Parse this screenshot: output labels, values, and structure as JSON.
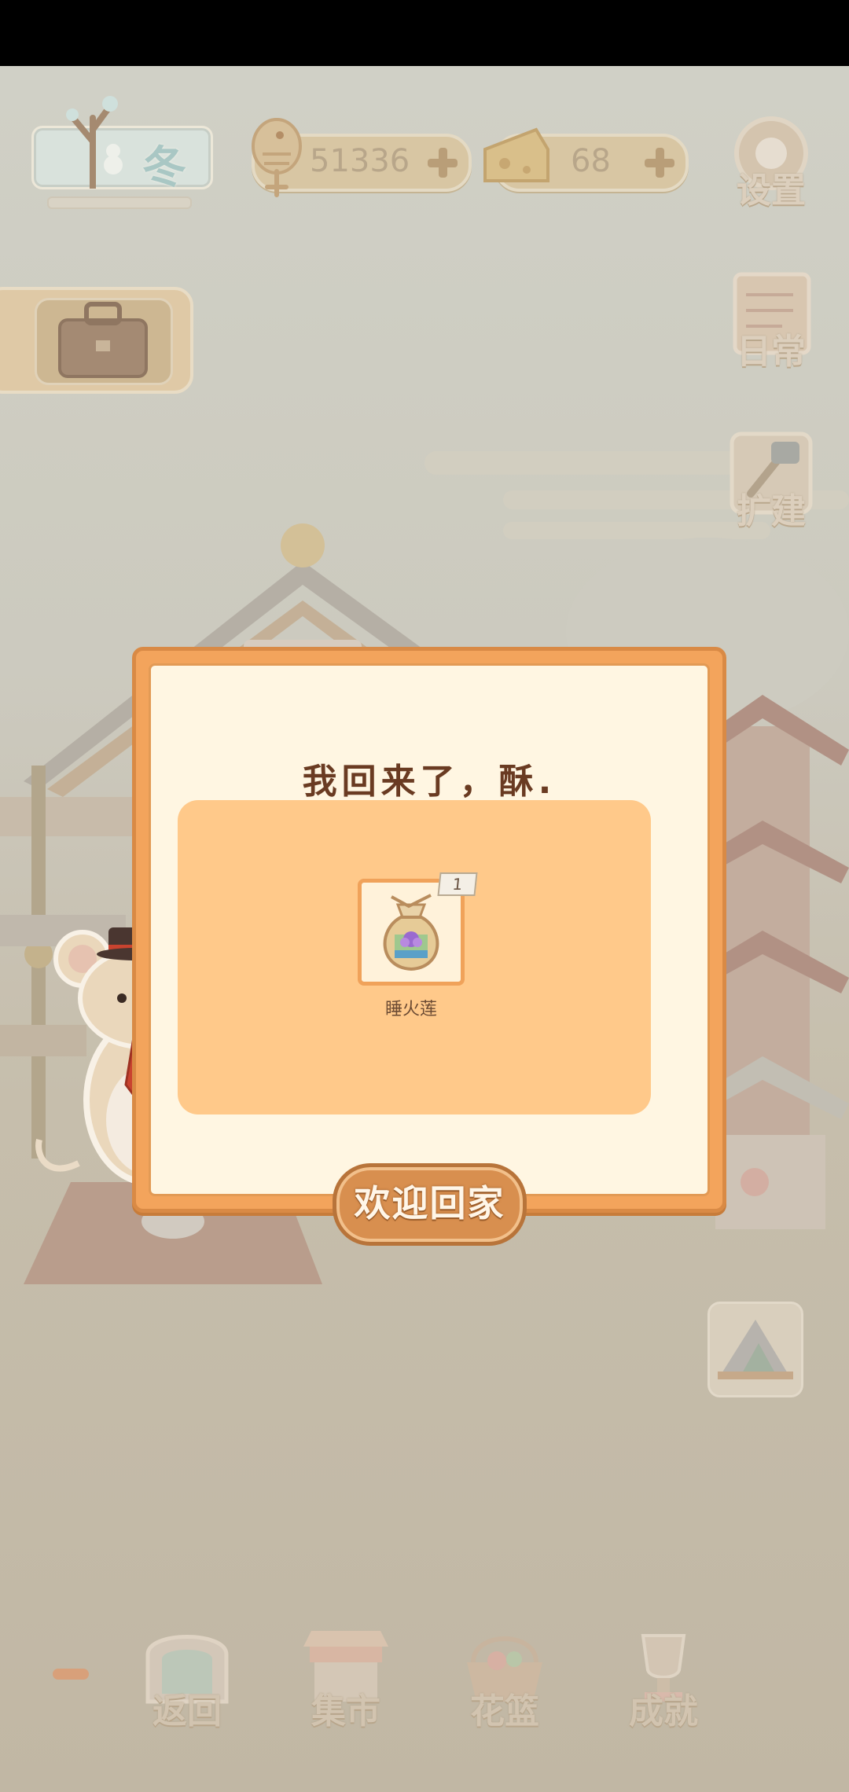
{
  "hud": {
    "season": "冬",
    "fish_currency": "51336",
    "cheese_currency": "68",
    "settings_label": "设置",
    "daily_label": "日常",
    "expand_label": "扩建"
  },
  "dialog": {
    "title": "我回来了，酥.",
    "item_name": "睡火莲",
    "item_count": "1",
    "confirm_label": "欢迎回家"
  },
  "nav": {
    "back_label": "返回",
    "market_label": "集市",
    "basket_label": "花篮",
    "achievement_label": "成就"
  },
  "colors": {
    "dialog_orange": "#f3a45c",
    "panel_peach": "#ffc98a",
    "button_brown": "#d88f4f"
  }
}
